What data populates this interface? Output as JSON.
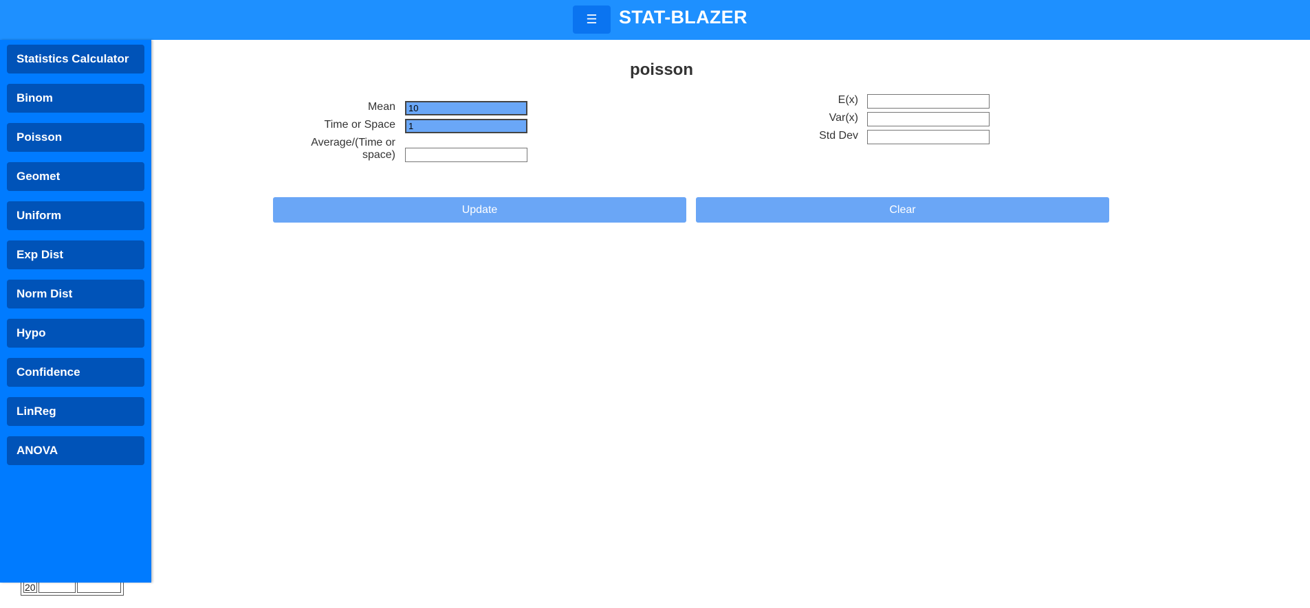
{
  "header": {
    "menu_icon": "☰",
    "title": "STAT-BLAZER"
  },
  "sidebar": {
    "items": [
      {
        "label": "Statistics Calculator"
      },
      {
        "label": "Binom"
      },
      {
        "label": "Poisson"
      },
      {
        "label": "Geomet"
      },
      {
        "label": "Uniform"
      },
      {
        "label": "Exp Dist"
      },
      {
        "label": "Norm Dist"
      },
      {
        "label": "Hypo"
      },
      {
        "label": "Confidence"
      },
      {
        "label": "LinReg"
      },
      {
        "label": "ANOVA"
      }
    ]
  },
  "main": {
    "heading": "poisson",
    "inputs": {
      "mean": {
        "label": "Mean",
        "value": "10"
      },
      "time_or_space": {
        "label": "Time or Space",
        "value": "1"
      },
      "average": {
        "label_line1": "Average/(Time or",
        "label_line2": "space)",
        "value": ""
      }
    },
    "outputs": {
      "ex": {
        "label": "E(x)",
        "value": ""
      },
      "varx": {
        "label": "Var(x)",
        "value": ""
      },
      "stddev": {
        "label": "Std Dev",
        "value": ""
      }
    },
    "update_label": "Update",
    "clear_label": "Clear"
  },
  "leftover_table": {
    "first_cell": "20"
  }
}
